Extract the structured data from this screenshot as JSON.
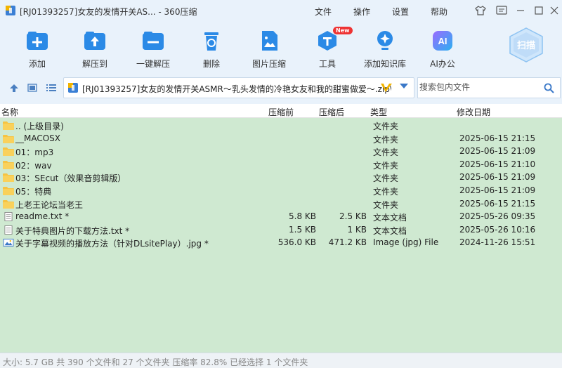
{
  "window": {
    "title": "[RJ01393257]女友的发情开关AS... - 360压缩",
    "menus": [
      "文件",
      "操作",
      "设置",
      "帮助"
    ]
  },
  "toolbar": {
    "items": [
      {
        "label": "添加",
        "icon": "add-icon"
      },
      {
        "label": "解压到",
        "icon": "extract-to-icon"
      },
      {
        "label": "一键解压",
        "icon": "one-click-extract-icon"
      },
      {
        "label": "删除",
        "icon": "trash-icon"
      },
      {
        "label": "图片压缩",
        "icon": "image-compress-icon"
      },
      {
        "label": "工具",
        "icon": "tools-icon",
        "badge": "New"
      },
      {
        "label": "添加知识库",
        "icon": "knowledge-base-icon"
      },
      {
        "label": "AI办公",
        "icon": "ai-office-icon"
      }
    ],
    "ai_text": "AI",
    "scan_label": "扫描"
  },
  "addressbar": {
    "path": "[RJ01393257]女友的发情开关ASMR～乳头发情的冷艳女友和我的甜蜜做爱～.zip\\",
    "search_placeholder": "搜索包内文件"
  },
  "columns": {
    "name": "名称",
    "compressed": "压缩前",
    "after": "压缩后",
    "type": "类型",
    "modified": "修改日期"
  },
  "files": [
    {
      "name": ".. (上级目录)",
      "before": "",
      "after": "",
      "type": "文件夹",
      "date": "",
      "kind": "folder"
    },
    {
      "name": "__MACOSX",
      "before": "",
      "after": "",
      "type": "文件夹",
      "date": "2025-06-15 21:15",
      "kind": "folder"
    },
    {
      "name": "01：mp3",
      "before": "",
      "after": "",
      "type": "文件夹",
      "date": "2025-06-15 21:09",
      "kind": "folder"
    },
    {
      "name": "02：wav",
      "before": "",
      "after": "",
      "type": "文件夹",
      "date": "2025-06-15 21:10",
      "kind": "folder"
    },
    {
      "name": "03：SEcut（效果音剪辑版）",
      "before": "",
      "after": "",
      "type": "文件夹",
      "date": "2025-06-15 21:09",
      "kind": "folder"
    },
    {
      "name": "05：特典",
      "before": "",
      "after": "",
      "type": "文件夹",
      "date": "2025-06-15 21:09",
      "kind": "folder"
    },
    {
      "name": "上老王论坛当老王",
      "before": "",
      "after": "",
      "type": "文件夹",
      "date": "2025-06-15 21:15",
      "kind": "folder"
    },
    {
      "name": "readme.txt *",
      "before": "5.8 KB",
      "after": "2.5 KB",
      "type": "文本文档",
      "date": "2025-05-26 09:35",
      "kind": "txt"
    },
    {
      "name": "关于特典图片的下载方法.txt *",
      "before": "1.5 KB",
      "after": "1 KB",
      "type": "文本文档",
      "date": "2025-05-26 10:16",
      "kind": "txt"
    },
    {
      "name": "关于字幕视频的播放方法（针对DLsitePlay）.jpg *",
      "before": "536.0 KB",
      "after": "471.2 KB",
      "type": "Image (jpg) File",
      "date": "2024-11-26 15:51",
      "kind": "jpg"
    }
  ],
  "status": {
    "text": "大小: 5.7 GB 共 390 个文件和 27 个文件夹 压缩率 82.8% 已经选择 1 个文件夹"
  }
}
